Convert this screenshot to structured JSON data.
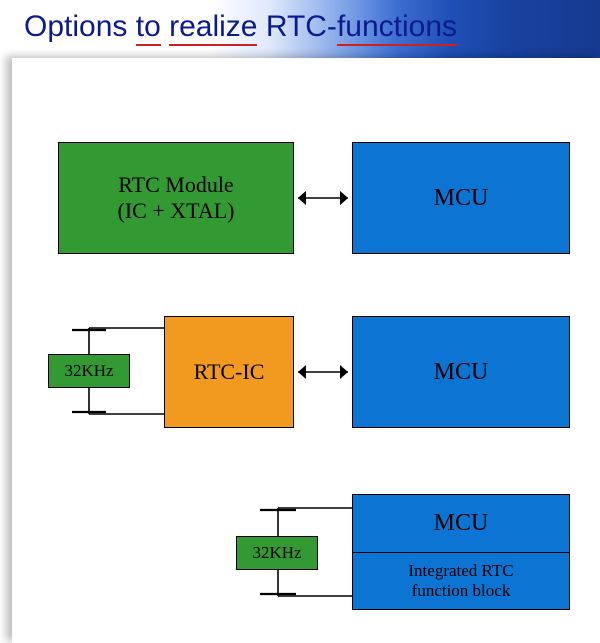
{
  "title": {
    "prefix": "Options ",
    "spell1": "to",
    "sep1": " ",
    "spell2": "realize",
    "sep2": " RTC-",
    "spell3": "functions"
  },
  "opt1": {
    "left_line1": "RTC Module",
    "left_line2": "(IC + XTAL)",
    "right": "MCU"
  },
  "opt2": {
    "crystal": "32KHz",
    "mid": "RTC-IC",
    "right": "MCU"
  },
  "opt3": {
    "crystal": "32KHz",
    "mcu": "MCU",
    "sub": "Integrated RTC\nfunction block"
  }
}
